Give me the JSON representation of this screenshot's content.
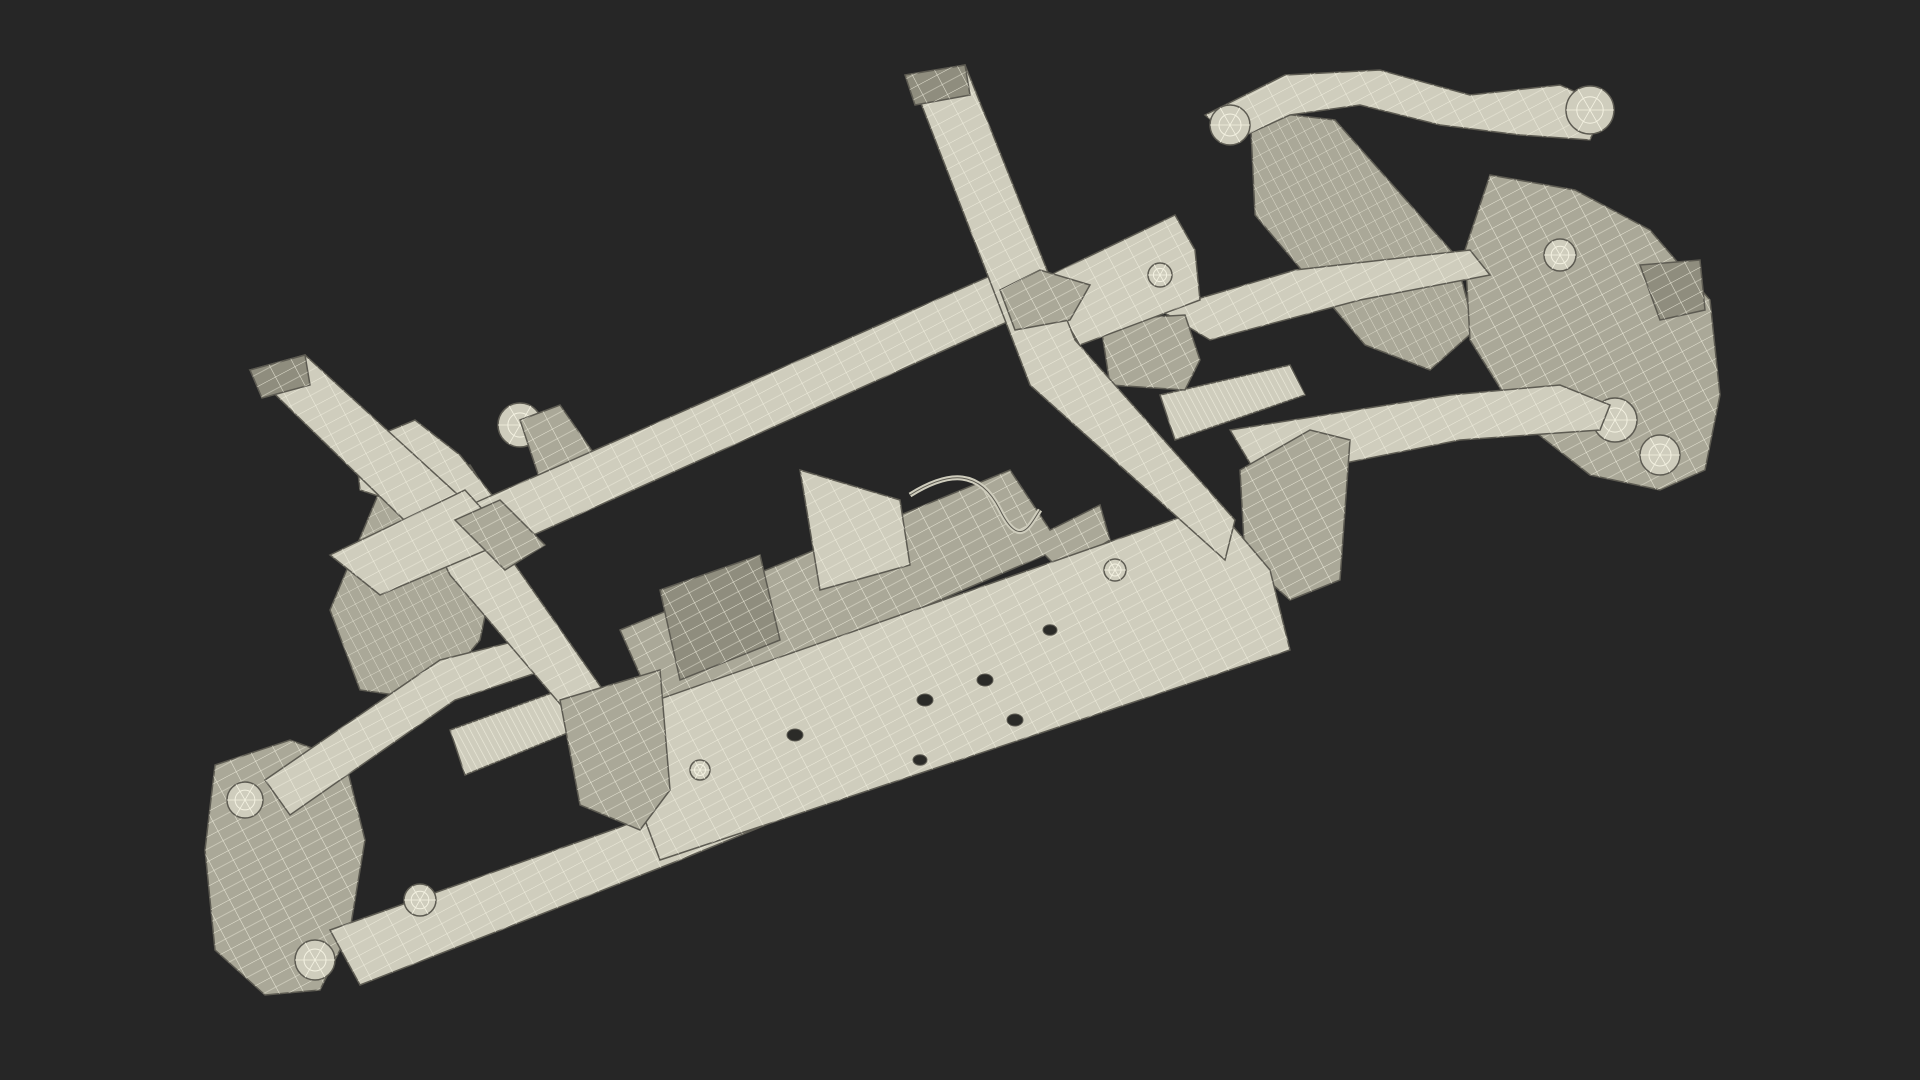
{
  "scene": {
    "subject": "wireframe-suspension-assembly",
    "colors": {
      "background": "#262626",
      "surface": "#cfcdbd",
      "surface_shade": "#aaa898",
      "surface_dark": "#8f8d7e",
      "wire": "#f4f2e2",
      "edge": "#5d5b52",
      "hole": "#2b2b28"
    }
  }
}
